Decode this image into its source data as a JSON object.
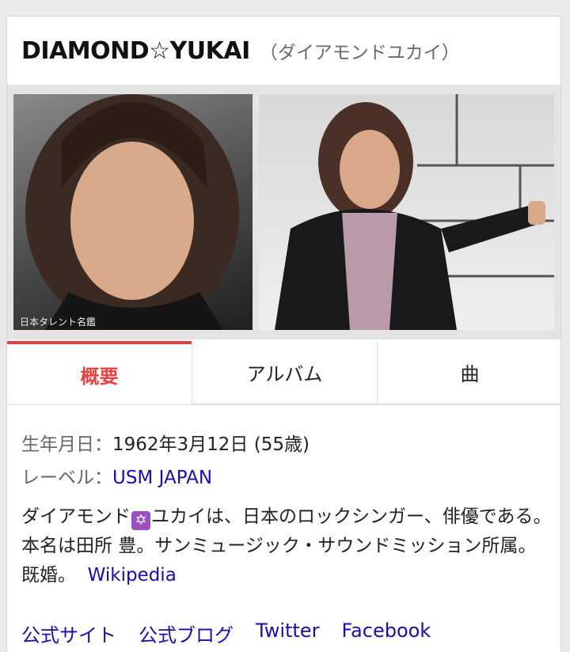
{
  "header": {
    "title": "DIAMOND☆YUKAI",
    "reading": "（ダイアモンドユカイ）"
  },
  "gallery": {
    "photo1_caption": "日本タレント名鑑"
  },
  "tabs": [
    {
      "label": "概要",
      "active": true
    },
    {
      "label": "アルバム",
      "active": false
    },
    {
      "label": "曲",
      "active": false
    }
  ],
  "facts": {
    "birth_label": "生年月日：",
    "birth_value": "1962年3月12日 (55歳)",
    "label_label": "レーベル：",
    "label_value": "USM JAPAN"
  },
  "description": {
    "part1": "ダイアモンド",
    "part2": "ユカイは、日本のロックシンガー、俳優である。本名は田所 豊。サンミュージック・サウンドミッション所属。既婚。",
    "source": "Wikipedia"
  },
  "links": {
    "official_site": "公式サイト",
    "official_blog": "公式ブログ",
    "twitter": "Twitter",
    "facebook": "Facebook"
  },
  "colors": {
    "accent": "#e8413f",
    "link": "#1a0dab",
    "star_emoji_bg": "#9c4fc1"
  }
}
